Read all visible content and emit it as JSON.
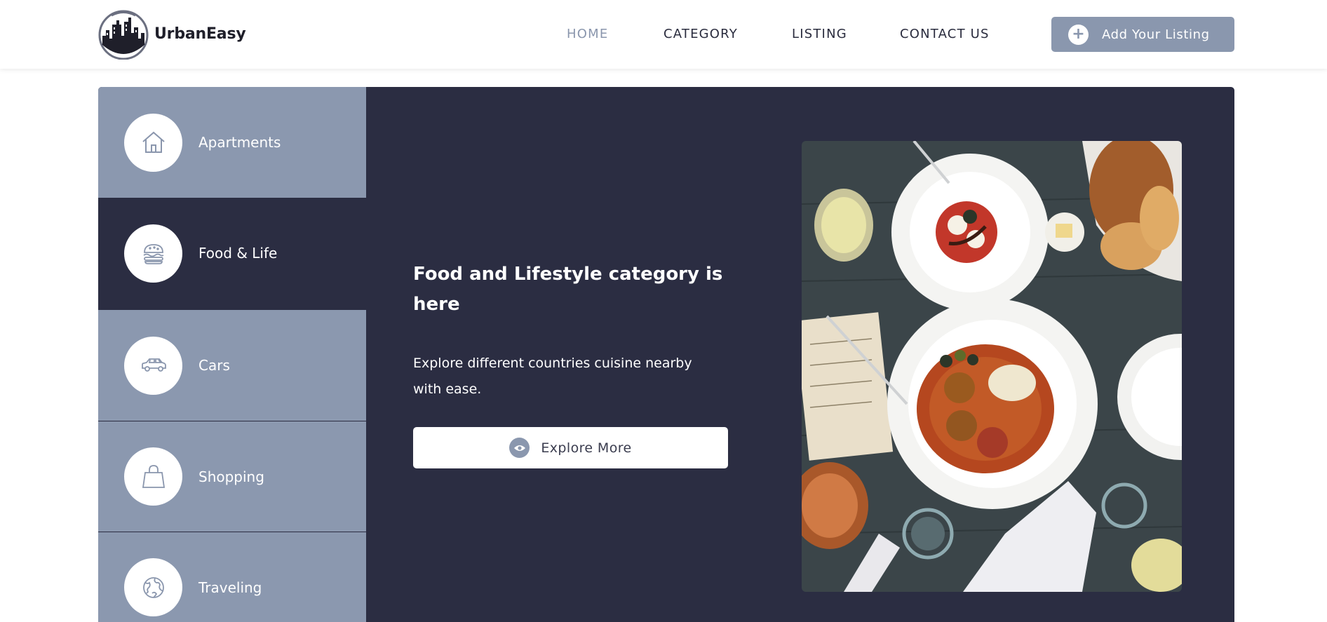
{
  "brand": {
    "name": "UrbanEasy",
    "logo_icon": "city-skyline-logo"
  },
  "nav": {
    "items": [
      {
        "label": "HOME",
        "active": true
      },
      {
        "label": "CATEGORY",
        "active": false
      },
      {
        "label": "LISTING",
        "active": false
      },
      {
        "label": "CONTACT US",
        "active": false
      }
    ],
    "cta": {
      "label": "Add Your Listing",
      "icon": "plus-icon"
    }
  },
  "categories": [
    {
      "label": "Apartments",
      "icon": "house-icon",
      "active": false
    },
    {
      "label": "Food & Life",
      "icon": "burger-icon",
      "active": true
    },
    {
      "label": "Cars",
      "icon": "car-icon",
      "active": false
    },
    {
      "label": "Shopping",
      "icon": "shopping-bag-icon",
      "active": false
    },
    {
      "label": "Traveling",
      "icon": "globe-icon",
      "active": false
    }
  ],
  "feature": {
    "headline": "Food and Lifestyle category is here",
    "description": "Explore different countries cuisine nearby with ease.",
    "button": {
      "label": "Explore More",
      "icon": "eye-icon"
    },
    "image": "overhead-restaurant-table-photo"
  },
  "colors": {
    "navy": "#2b2d42",
    "slate": "#8b98af",
    "nav_active": "#8a96ad",
    "white": "#ffffff"
  }
}
